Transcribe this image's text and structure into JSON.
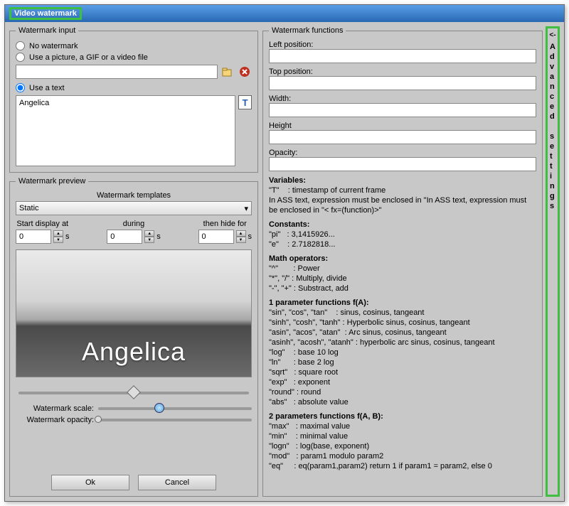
{
  "window": {
    "title": "Video watermark"
  },
  "input_group": {
    "legend": "Watermark input",
    "opt_none": "No watermark",
    "opt_file": "Use a picture, a GIF or a video file",
    "opt_text": "Use a text",
    "file_value": "",
    "text_value": "Angelica",
    "selected": "text"
  },
  "preview_group": {
    "legend": "Watermark preview",
    "templates_label": "Watermark templates",
    "combo_value": "Static",
    "start_label": "Start display at",
    "during_label": "during",
    "hide_label": "then hide for",
    "unit": "s",
    "start_val": "0",
    "during_val": "0",
    "hide_val": "0",
    "preview_text": "Angelica",
    "scale_label": "Watermark scale:",
    "opacity_label": "Watermark opacity:"
  },
  "buttons": {
    "ok": "Ok",
    "cancel": "Cancel"
  },
  "functions_group": {
    "legend": "Watermark functions",
    "left_label": "Left position:",
    "top_label": "Top position:",
    "width_label": "Width:",
    "height_label": "Height",
    "opacity_label": "Opacity:"
  },
  "help": {
    "vars_hdr": "Variables:",
    "vars_l1": "\"T\"    : timestamp of current frame",
    "vars_l2": "In ASS text, expression must be enclosed in \"In ASS text, expression must be enclosed in \"< fx=(function)>\"",
    "const_hdr": "Constants:",
    "const_l1": "\"pi\"   : 3,1415926...",
    "const_l2": "\"e\"    : 2.7182818...",
    "ops_hdr": "Math operators:",
    "ops_l1": "\"^\"       : Power",
    "ops_l2": "\"*\", \"/\" : Multiply, divide",
    "ops_l3": "\"-\", \"+\" : Substract, add",
    "f1_hdr": "1 parameter functions f(A):",
    "f1_l1": "\"sin\", \"cos\", \"tan\"    : sinus, cosinus, tangeant",
    "f1_l2": "\"sinh\", \"cosh\", \"tanh\" : Hyperbolic sinus, cosinus, tangeant",
    "f1_l3": "\"asin\", \"acos\", \"atan\"  : Arc sinus, cosinus, tangeant",
    "f1_l4": "\"asinh\", \"acosh\", \"atanh\" : hyperbolic arc sinus, cosinus, tangeant",
    "f1_l5": "\"log\"    : base 10 log",
    "f1_l6": "\"ln\"      : base 2 log",
    "f1_l7": "\"sqrt\"   : square root",
    "f1_l8": "\"exp\"   : exponent",
    "f1_l9": "\"round\" : round",
    "f1_l10": "\"abs\"   : absolute value",
    "f2_hdr": "2 parameters functions f(A, B):",
    "f2_l1": "\"max\"   : maximal value",
    "f2_l2": "\"min\"    : minimal value",
    "f2_l3": "\"logn\"   : log(base, exponent)",
    "f2_l4": "\"mod\"   : param1 modulo param2",
    "f2_l5": "\"eq\"     : eq(param1,param2) return 1 if param1 = param2, else 0"
  },
  "side": {
    "arrow": "<-",
    "text": "Advanced settings"
  }
}
